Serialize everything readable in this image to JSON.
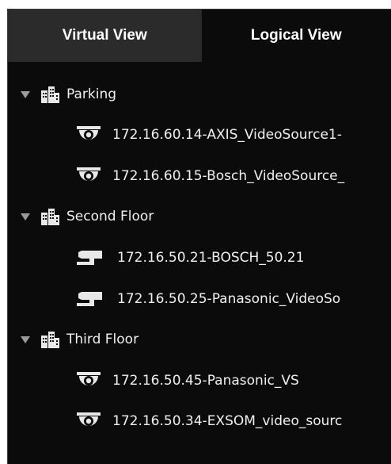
{
  "tabs": [
    {
      "label": "Virtual View",
      "active": true
    },
    {
      "label": "Logical View",
      "active": false
    }
  ],
  "colors": {
    "panel_background": "#0b0b0b",
    "active_tab_background": "#2b2b2b",
    "text": "#f0f0f0",
    "icon": "#e8e8e8",
    "caret": "#9a9a9a"
  },
  "tree": {
    "groups": [
      {
        "label": "Parking",
        "icon": "building-icon",
        "expanded": true,
        "cameras": [
          {
            "label": "172.16.60.14-AXIS_VideoSource1-",
            "icon": "dome-camera-icon"
          },
          {
            "label": "172.16.60.15-Bosch_VideoSource_",
            "icon": "dome-camera-icon"
          }
        ]
      },
      {
        "label": "Second Floor",
        "icon": "building-icon",
        "expanded": true,
        "cameras": [
          {
            "label": "172.16.50.21-BOSCH_50.21",
            "icon": "bullet-camera-icon"
          },
          {
            "label": "172.16.50.25-Panasonic_VideoSo",
            "icon": "bullet-camera-icon"
          }
        ]
      },
      {
        "label": "Third Floor",
        "icon": "building-icon",
        "expanded": true,
        "cameras": [
          {
            "label": "172.16.50.45-Panasonic_VS",
            "icon": "dome-camera-icon"
          },
          {
            "label": "172.16.50.34-EXSOM_video_sourc",
            "icon": "dome-camera-icon"
          }
        ]
      }
    ]
  }
}
